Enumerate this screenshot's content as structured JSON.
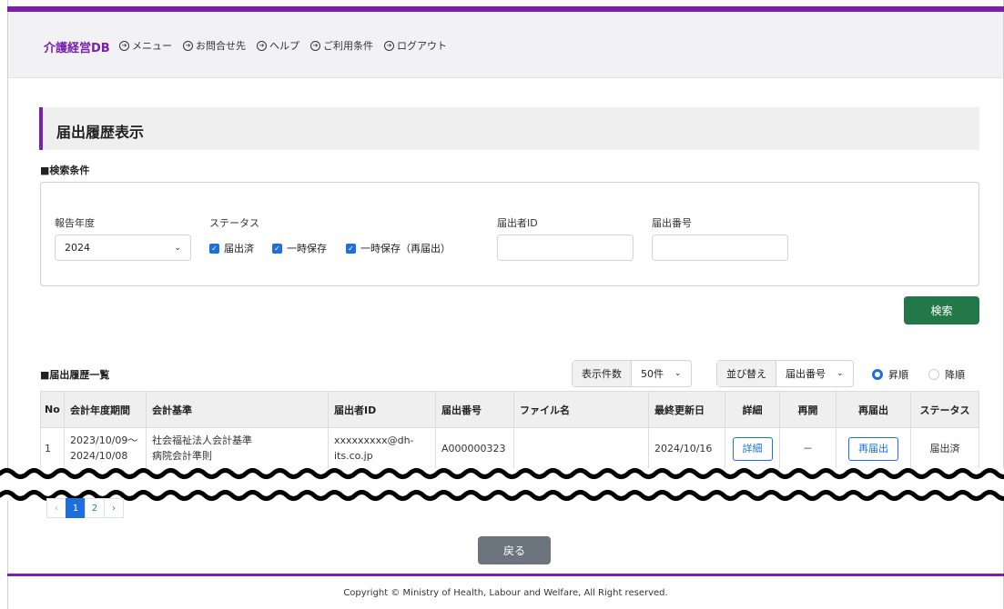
{
  "header": {
    "brand": "介護経営DB",
    "nav": [
      {
        "label": "メニュー",
        "icon": "arrow-circle-icon"
      },
      {
        "label": "お問合せ先",
        "icon": "arrow-circle-icon"
      },
      {
        "label": "ヘルプ",
        "icon": "arrow-circle-icon"
      },
      {
        "label": "ご利用条件",
        "icon": "arrow-circle-icon"
      },
      {
        "label": "ログアウト",
        "icon": "arrow-circle-icon"
      }
    ]
  },
  "page_title": "届出履歴表示",
  "search": {
    "section_label": "■検索条件",
    "year_label": "報告年度",
    "year_value": "2024",
    "status_label": "ステータス",
    "status_options": [
      "届出済",
      "一時保存",
      "一時保存（再届出）"
    ],
    "submitter_id_label": "届出者ID",
    "submitter_id_value": "",
    "filing_number_label": "届出番号",
    "filing_number_value": "",
    "search_button": "検索"
  },
  "list": {
    "section_label": "■届出履歴一覧",
    "page_size_label": "表示件数",
    "page_size_value": "50件",
    "sort_label": "並び替え",
    "sort_value": "届出番号",
    "order_asc": "昇順",
    "order_desc": "降順",
    "columns": [
      "No",
      "会計年度期間",
      "会計基準",
      "届出者ID",
      "届出番号",
      "ファイル名",
      "最終更新日",
      "詳細",
      "再開",
      "再届出",
      "ステータス"
    ],
    "rows": [
      {
        "no": "1",
        "period_line1": "2023/10/09～",
        "period_line2": "2024/10/08",
        "standard_line1": "社会福祉法人会計基準",
        "standard_line2": "病院会計準則",
        "submitter_line1": "xxxxxxxxx@dh-",
        "submitter_line2": "its.co.jp",
        "filing_number": "A000000323",
        "file_name": "",
        "last_updated": "2024/10/16",
        "detail_button": "詳細",
        "resume": "－",
        "refile_button": "再届出",
        "status": "届出済"
      }
    ]
  },
  "pagination": {
    "prev": "‹",
    "pages": [
      "1",
      "2"
    ],
    "current": "1",
    "next": "›"
  },
  "back_button": "戻る",
  "footer": "Copyright © Ministry of Health, Labour and Welfare, All Right reserved.",
  "colors": {
    "accent": "#7a1fb0",
    "primary": "#1e6fd9",
    "success": "#23784a",
    "secondary": "#6c757d"
  }
}
